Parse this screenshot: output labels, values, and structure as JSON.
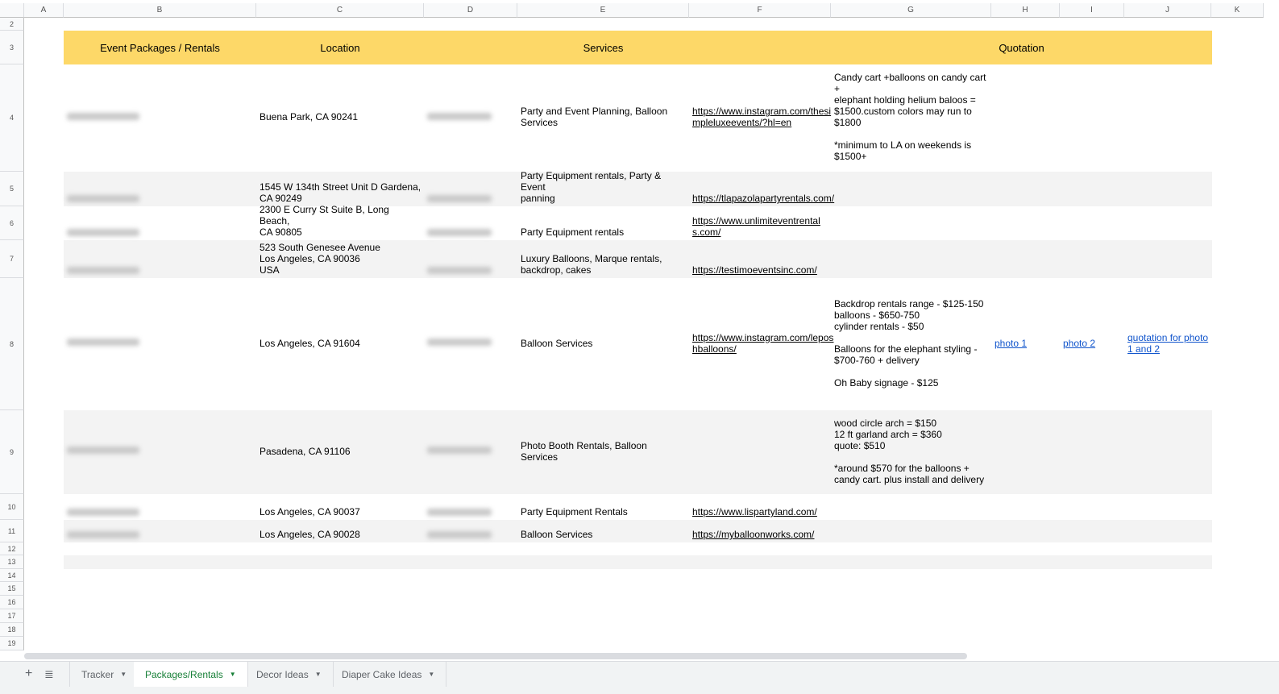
{
  "columns": [
    "A",
    "B",
    "C",
    "D",
    "E",
    "F",
    "G",
    "H",
    "I",
    "J",
    "K"
  ],
  "row_numbers": [
    "2",
    "3",
    "4",
    "5",
    "6",
    "7",
    "8",
    "9",
    "10",
    "11",
    "12",
    "13",
    "14",
    "15",
    "16",
    "17",
    "18",
    "19"
  ],
  "header": {
    "packages": "Event Packages / Rentals",
    "location": "Location",
    "services": "Services",
    "quotation": "Quotation"
  },
  "rows": [
    {
      "location": "Buena Park, CA 90241",
      "services": "Party and Event Planning, Balloon\nServices",
      "link": "https://www.instagram.com/thesi\nmpleluxeevents/?hl=en",
      "quote": "Candy cart +balloons on candy cart +\nelephant holding helium baloos =\n$1500.custom colors may run to\n$1800\n\n*minimum to LA on weekends is\n$1500+"
    },
    {
      "location": "1545 W 134th Street Unit D Gardena,\nCA 90249",
      "services": "Party Equipment rentals, Party & Event\npanning",
      "link": "https://tlapazolapartyrentals.com/"
    },
    {
      "location": "2300 E Curry St Suite B, Long Beach,\nCA 90805",
      "services": "Party Equipment rentals",
      "link": "https://www.unlimiteventrental\ns.com/"
    },
    {
      "location": "523 South Genesee Avenue\nLos Angeles, CA 90036\nUSA",
      "services": "Luxury Balloons, Marque rentals,\nbackdrop, cakes",
      "link": "https://testimoeventsinc.com/"
    },
    {
      "location": "Los Angeles, CA 91604",
      "services": "Balloon Services",
      "link": "https://www.instagram.com/lepos\nhballoons/",
      "quote": "Backdrop rentals range - $125-150\nballoons - $650-750\ncylinder rentals - $50\n\nBalloons for the elephant styling -\n$700-760 + delivery\n\nOh Baby signage - $125",
      "photo1": "photo 1",
      "photo2": "photo 2",
      "photo_quote": "quotation for photo\n1 and 2"
    },
    {
      "location": "Pasadena, CA 91106",
      "services": "Photo Booth Rentals, Balloon Services",
      "quote": "wood circle arch = $150\n12 ft garland arch = $360\nquote: $510\n\n*around $570 for the balloons +\ncandy cart. plus install and delivery"
    },
    {
      "location": "Los Angeles, CA 90037",
      "services": "Party Equipment Rentals",
      "link": "https://www.lispartyland.com/"
    },
    {
      "location": "Los Angeles, CA 90028",
      "services": "Balloon Services",
      "link": "https://myballoonworks.com/"
    }
  ],
  "tabs": {
    "add": "+",
    "menu": "≣",
    "items": [
      "Tracker",
      "Packages/Rentals",
      "Decor Ideas",
      "Diaper Cake Ideas"
    ],
    "active": "Packages/Rentals"
  },
  "colors": {
    "header_yellow": "#fdd868",
    "tab_active": "#188038",
    "link_blue": "#1155cc"
  }
}
